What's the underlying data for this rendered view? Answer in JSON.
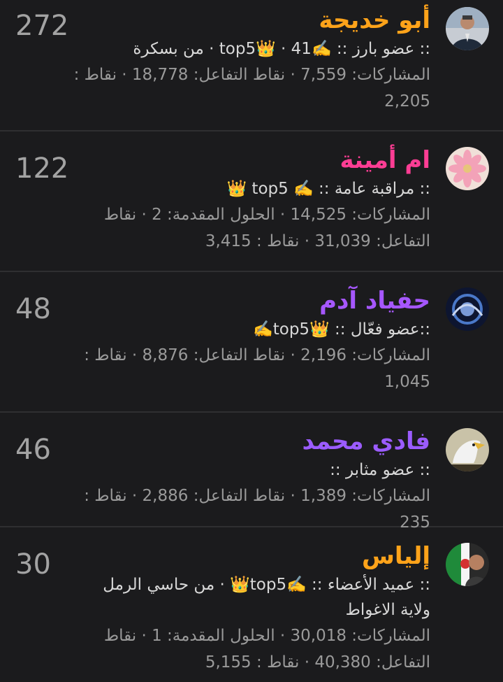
{
  "colors": {
    "background": "#1b1b1d",
    "divider": "#2f2f31",
    "name_orange": "#ffa31a",
    "name_pink": "#ff3d94",
    "name_purple": "#a657ff",
    "name_violet": "#9b5cff",
    "score": "#a3a3a3"
  },
  "members": [
    {
      "name": "أبو خديجة",
      "name_color": "#ffa31a",
      "score": "272",
      "title": ":: عضو بارز :: ✍️top5👑 · 41 · من بسكرة",
      "stats": "المشاركات: 7,559 · نقاط التفاعل: 18,778 · نقاط : 2,205",
      "avatar_icon": "man-in-suit-avatar"
    },
    {
      "name": "ام أمينة",
      "name_color": "#ff3d94",
      "score": "122",
      "title": ":: مراقبة عامة :: ✍️ top5 👑",
      "stats": "المشاركات: 14,525 · الحلول المقدمة: 2 · نقاط التفاعل: 31,039 · نقاط : 3,415",
      "avatar_icon": "pink-flower-avatar"
    },
    {
      "name": "حفياد آدم",
      "name_color": "#a657ff",
      "score": "48",
      "title": "::عضو فعّال :: 👑top5✍️",
      "stats": "المشاركات: 2,196 · نقاط التفاعل: 8,876 · نقاط : 1,045",
      "avatar_icon": "blue-ornament-avatar"
    },
    {
      "name": "فادي محمد",
      "name_color": "#9b5cff",
      "score": "46",
      "title": ":: عضو مثابر ::",
      "stats": "المشاركات: 1,389 · نقاط التفاعل: 2,886 · نقاط : 235",
      "avatar_icon": "eagle-avatar"
    },
    {
      "name": "إلياس",
      "name_color": "#ffa31a",
      "score": "30",
      "title": ":: عميد الأعضاء :: ✍️top5👑 · من حاسي الرمل ولاية الاغواط",
      "stats": "المشاركات: 30,018 · الحلول المقدمة: 1 · نقاط التفاعل: 40,380 · نقاط : 5,155",
      "avatar_icon": "flag-man-avatar"
    }
  ]
}
